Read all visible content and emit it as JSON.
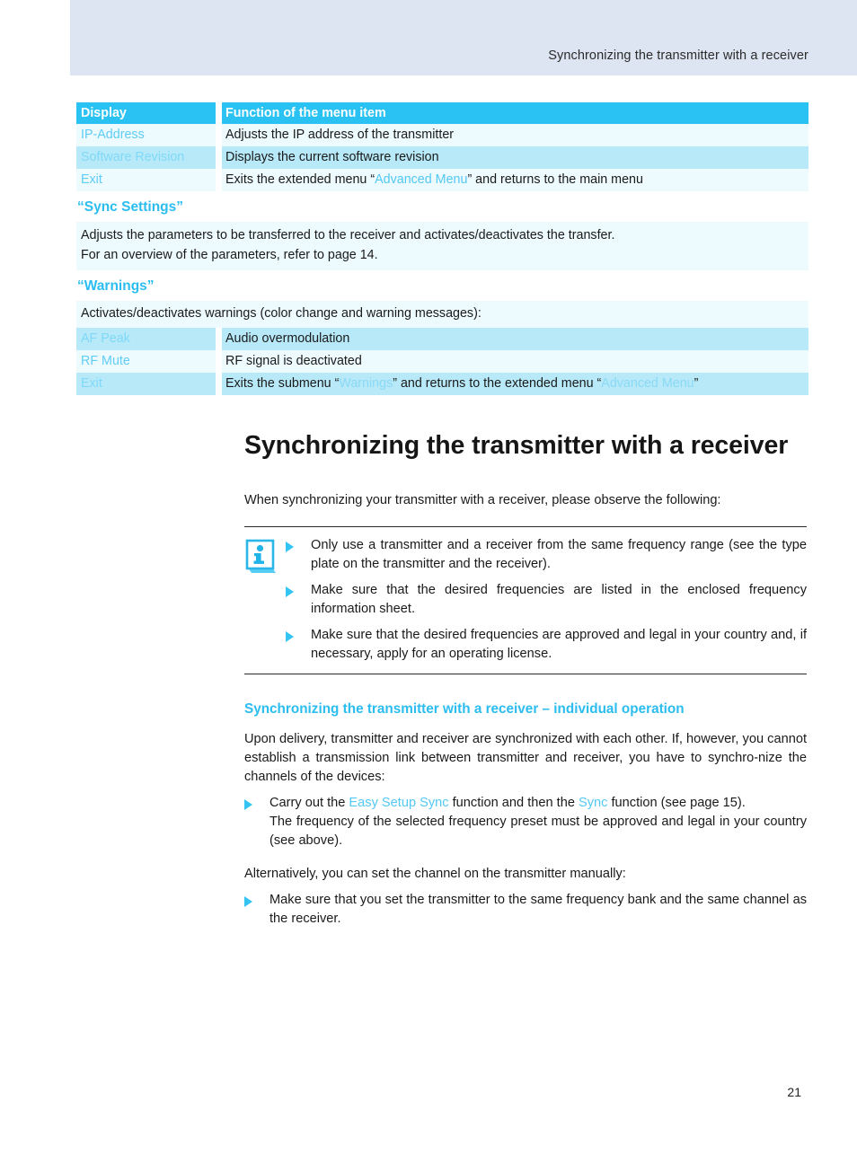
{
  "header": {
    "title": "Synchronizing the transmitter with a receiver"
  },
  "menu_table": {
    "columns": [
      "Display",
      "Function of the menu item"
    ],
    "rows": [
      {
        "display": "IP-Address",
        "function_pre": "Adjusts the IP address of the transmitter",
        "function_ref": "",
        "function_post": ""
      },
      {
        "display": "Software Revision",
        "function_pre": "Displays the current software revision",
        "function_ref": "",
        "function_post": ""
      },
      {
        "display": "Exit",
        "function_pre": "Exits the extended menu “",
        "function_ref": "Advanced Menu",
        "function_post": "” and returns to the main menu"
      }
    ]
  },
  "sync_settings": {
    "heading": "“Sync Settings”",
    "line1": "Adjusts the parameters to be transferred to the receiver and activates/deactivates the transfer.",
    "line2": "For an overview of the parameters, refer to page 14."
  },
  "warnings": {
    "heading": "“Warnings”",
    "intro": "Activates/deactivates warnings (color change and warning messages):",
    "rows": [
      {
        "display": "AF Peak",
        "function": "Audio overmodulation"
      },
      {
        "display": "RF Mute",
        "function": "RF signal is deactivated"
      }
    ],
    "exit_row": {
      "display": "Exit",
      "part1": "Exits the submenu “",
      "ref1": "Warnings",
      "part2": "” and returns to the extended menu “",
      "ref2": "Advanced Menu",
      "part3": "”"
    }
  },
  "main": {
    "title": "Synchronizing the transmitter with a receiver",
    "lead": "When synchronizing your transmitter with a receiver, please observe the following:",
    "note_icon": "info-document-icon",
    "notes": [
      "Only use a transmitter and a receiver from the same frequency range (see the type plate on the transmitter and the receiver).",
      "Make sure that the desired frequencies are listed in the enclosed frequency information sheet.",
      "Make sure that the desired frequencies are approved and legal in your country and, if necessary, apply for an operating license."
    ]
  },
  "individual": {
    "heading": "Synchronizing the transmitter with a receiver – individual operation",
    "paragraph": "Upon delivery, transmitter and receiver are synchronized with each other. If, however, you cannot establish a transmission link between transmitter and receiver, you have to synchro-nize the channels of the devices:",
    "bullet1_part1": "Carry out the ",
    "bullet1_ref1": "Easy Setup Sync",
    "bullet1_part2": " function and then the ",
    "bullet1_ref2": "Sync",
    "bullet1_part3": " function (see page 15).",
    "bullet1_line2": "The frequency of the selected frequency preset must be approved and legal in your country (see above).",
    "alt_paragraph": "Alternatively, you can set the channel on the transmitter manually:",
    "bullet2": "Make sure that you set the transmitter to the same frequency bank and the same channel as the receiver."
  },
  "footer": {
    "page_number": "21"
  },
  "colors": {
    "accent_cyan": "#2bbdf0",
    "table_header": "#29c2f3",
    "row_light": "#edfafe",
    "row_mid": "#b8e9f8",
    "header_band": "#dde5f2"
  }
}
